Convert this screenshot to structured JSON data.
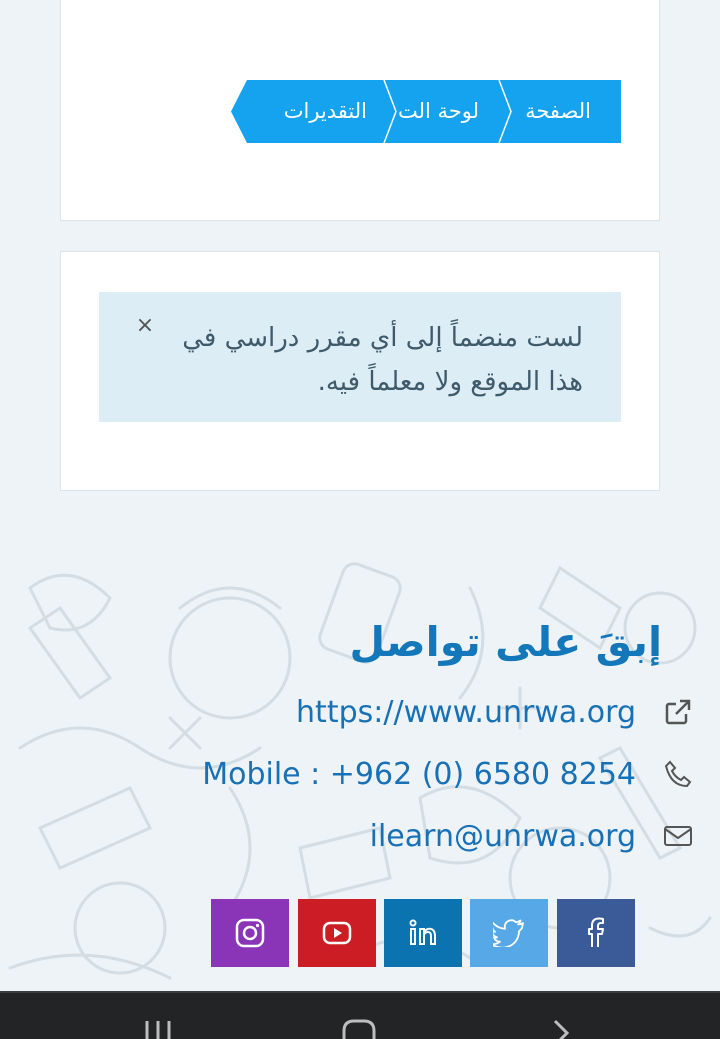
{
  "breadcrumb": {
    "items": [
      "الصفحة",
      "لوحة الت",
      "التقديرات"
    ]
  },
  "alert": {
    "message": "لست منضماً إلى أي مقرر دراسي في هذا الموقع ولا معلماً فيه.",
    "close_glyph": "×"
  },
  "footer": {
    "title": "إبقَ على تواصل",
    "website": "https://www.unrwa.org",
    "phone": "Mobile : +962 (0) 6580 8254",
    "email": "ilearn@unrwa.org",
    "social": [
      {
        "name": "instagram-icon",
        "color": "#8a35b8"
      },
      {
        "name": "youtube-icon",
        "color": "#cc1d24"
      },
      {
        "name": "linkedin-icon",
        "color": "#0a73b0"
      },
      {
        "name": "twitter-icon",
        "color": "#56a9e6"
      },
      {
        "name": "facebook-icon",
        "color": "#3a5a98"
      }
    ]
  },
  "colors": {
    "accent": "#15a3f0",
    "link": "#1870b5",
    "alert_bg": "#dcedf5"
  }
}
